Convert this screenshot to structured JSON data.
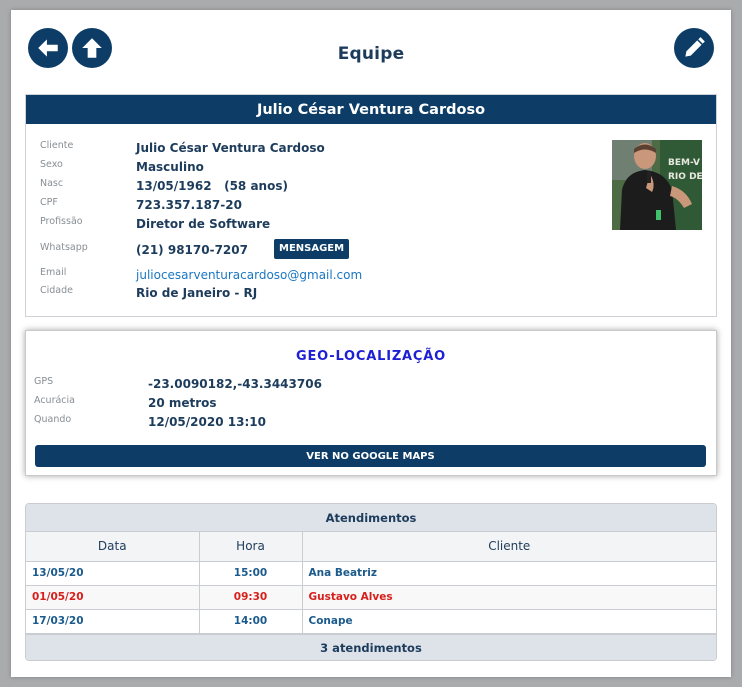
{
  "header": {
    "title": "Equipe",
    "back_icon": "arrow-left-icon",
    "up_icon": "arrow-up-icon",
    "edit_icon": "pencil-icon"
  },
  "profile": {
    "name": "Julio César Ventura Cardoso",
    "fields": [
      {
        "label": "Cliente",
        "value": "Julio César Ventura Cardoso"
      },
      {
        "label": "Sexo",
        "value": "Masculino"
      },
      {
        "label": "Nasc",
        "value": "13/05/1962   (58 anos)"
      },
      {
        "label": "CPF",
        "value": "723.357.187-20"
      },
      {
        "label": "Profissão",
        "value": "Diretor de Software"
      },
      {
        "label": "Whatsapp",
        "value": "(21) 98170-7207"
      },
      {
        "label": "Email",
        "value": "juliocesarventuracardoso@gmail.com"
      },
      {
        "label": "Cidade",
        "value": "Rio de Janeiro - RJ"
      }
    ],
    "message_button": "MENSAGEM",
    "photo_text": "BEM-V\nRIO DE"
  },
  "geo": {
    "title": "GEO-LOCALIZAÇÃO",
    "fields": [
      {
        "label": "GPS",
        "value": "-23.0090182,-43.3443706"
      },
      {
        "label": "Acurácia",
        "value": "20 metros"
      },
      {
        "label": "Quando",
        "value": "12/05/2020 13:10"
      }
    ],
    "maps_button": "VER NO GOOGLE MAPS"
  },
  "appointments": {
    "title": "Atendimentos",
    "columns": [
      "Data",
      "Hora",
      "Cliente"
    ],
    "rows": [
      {
        "date": "13/05/20",
        "time": "15:00",
        "client": "Ana Beatriz",
        "color": "#1b5a8c"
      },
      {
        "date": "01/05/20",
        "time": "09:30",
        "client": "Gustavo Alves",
        "color": "#d7201b"
      },
      {
        "date": "17/03/20",
        "time": "14:00",
        "client": "Conape",
        "color": "#1b5a8c"
      }
    ],
    "footer": "3 atendimentos"
  },
  "colors": {
    "primary": "#0d3d66",
    "link": "#1a77c4",
    "geo_title": "#1d1fd4",
    "alert": "#d7201b"
  }
}
